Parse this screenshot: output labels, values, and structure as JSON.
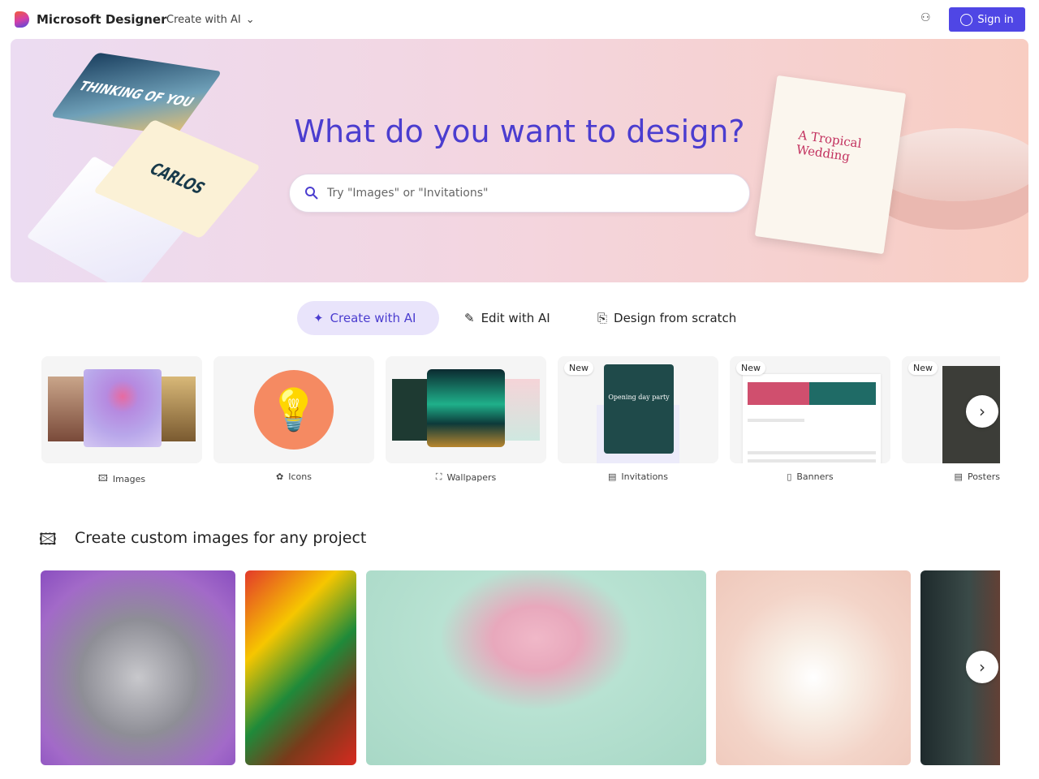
{
  "header": {
    "brand": "Microsoft Designer",
    "menu_label": "Create with AI",
    "sign_in": "Sign in",
    "brand_color": "#4f46e5"
  },
  "hero": {
    "title": "What do you want to design?",
    "search_placeholder": "Try \"Images\" or \"Invitations\"",
    "card_a_text": "THINKING OF YOU",
    "card_b_text": "CARLOS",
    "card_c_text": "A Tropical Wedding"
  },
  "tabs": [
    {
      "label": "Create with AI",
      "active": true
    },
    {
      "label": "Edit with AI",
      "active": false
    },
    {
      "label": "Design from scratch",
      "active": false
    }
  ],
  "categories": [
    {
      "label": "Images",
      "icon": "image-sparkle-icon",
      "new": false
    },
    {
      "label": "Icons",
      "icon": "icons-icon",
      "new": false
    },
    {
      "label": "Wallpapers",
      "icon": "wallpaper-icon",
      "new": false
    },
    {
      "label": "Invitations",
      "icon": "invitation-icon",
      "new": true
    },
    {
      "label": "Banners",
      "icon": "banner-icon",
      "new": true
    },
    {
      "label": "Posters",
      "icon": "poster-icon",
      "new": true
    }
  ],
  "new_badge": "New",
  "invitation_text": "Opening day party",
  "section": {
    "title": "Create custom images for any project"
  }
}
